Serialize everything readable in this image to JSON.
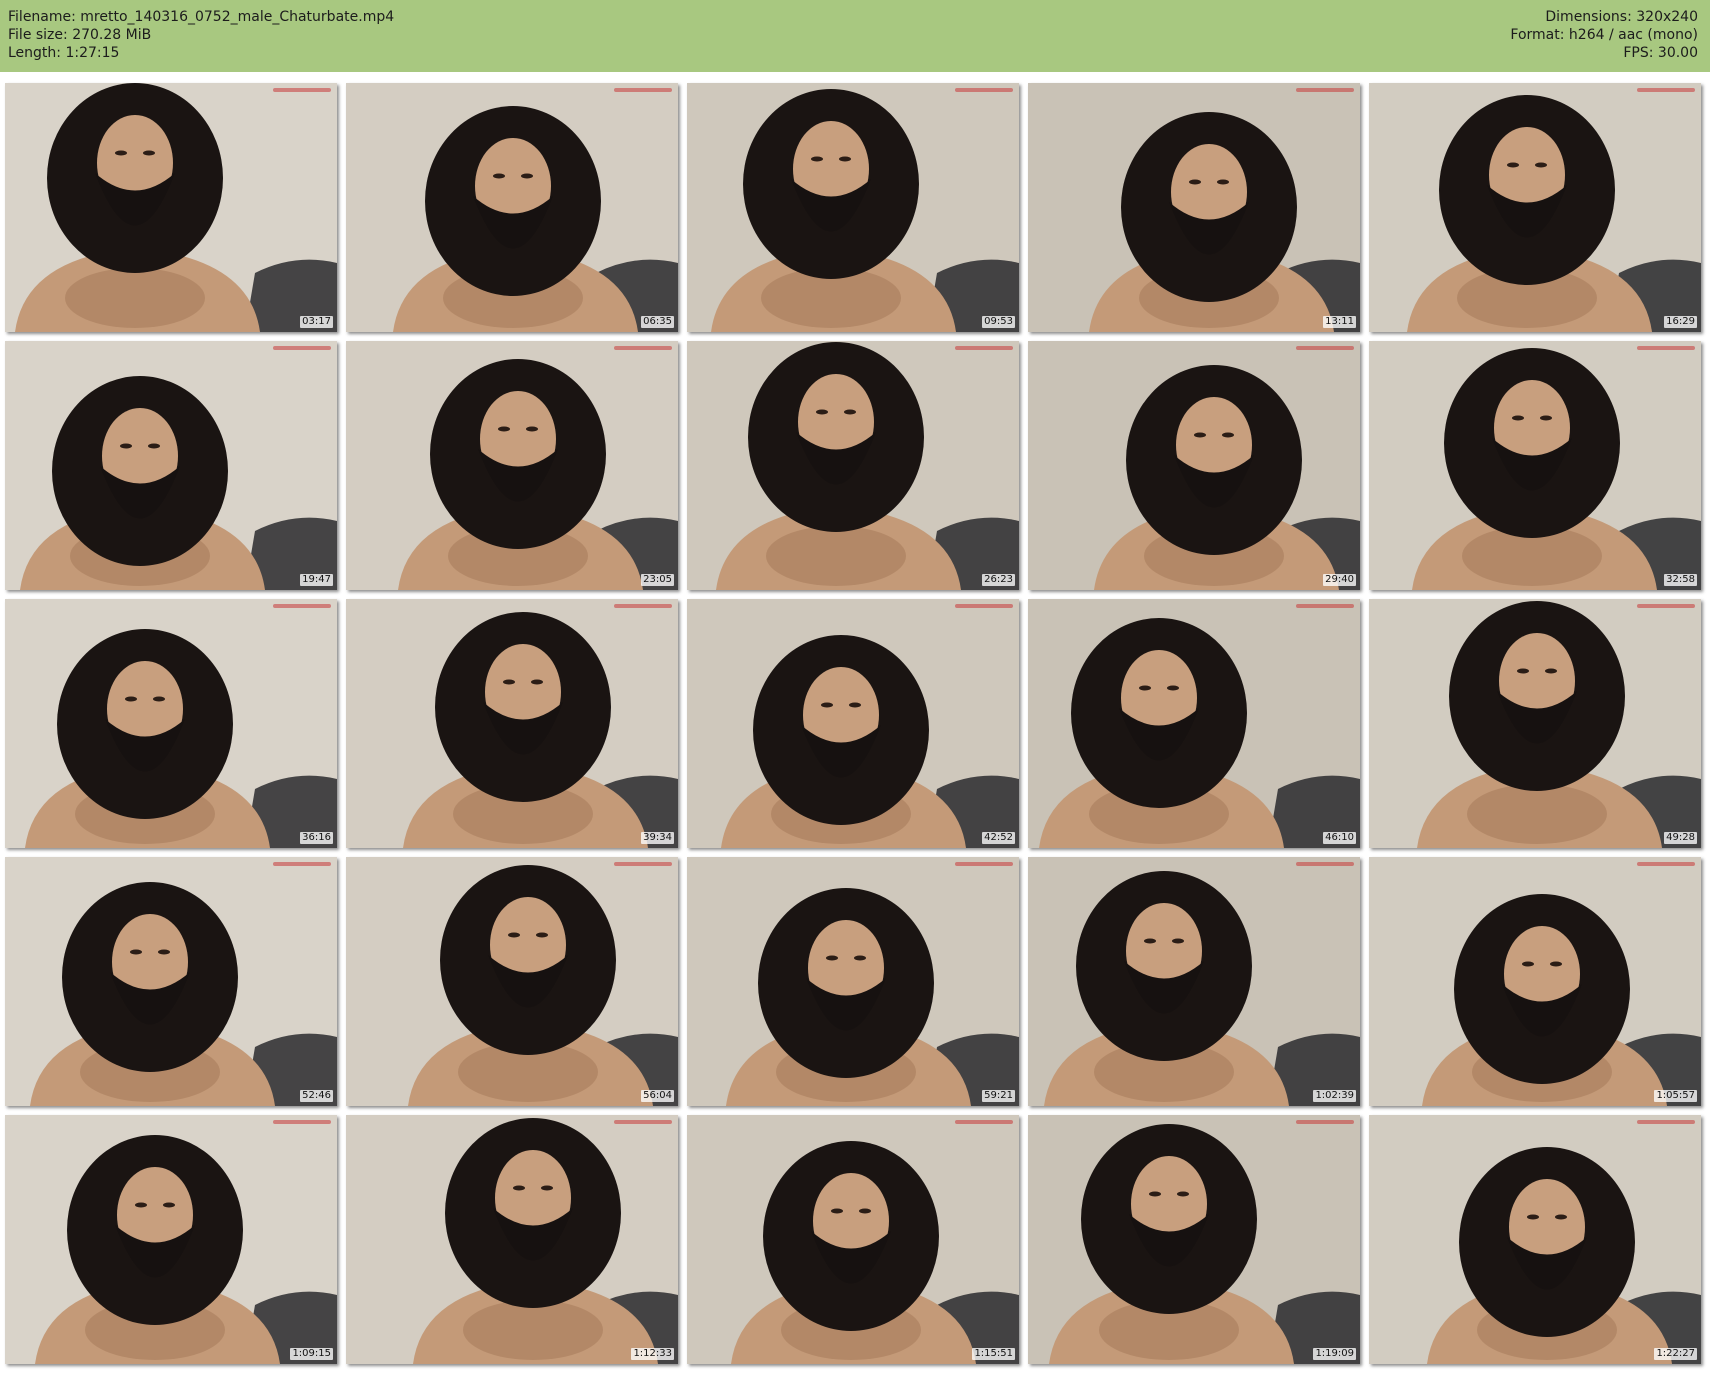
{
  "header": {
    "filename_line": "Filename: mretto_140316_0752_male_Chaturbate.mp4",
    "filesize_line": "File size: 270.28 MiB",
    "length_line": "Length: 1:27:15",
    "dimensions_line": "Dimensions: 320x240",
    "format_line": "Format: h264 / aac (mono)",
    "fps_line": "FPS: 30.00",
    "background_color": "#a8c880"
  },
  "thumbnails": [
    {
      "timestamp": "03:17"
    },
    {
      "timestamp": "06:35"
    },
    {
      "timestamp": "09:53"
    },
    {
      "timestamp": "13:11"
    },
    {
      "timestamp": "16:29"
    },
    {
      "timestamp": "19:47"
    },
    {
      "timestamp": "23:05"
    },
    {
      "timestamp": "26:23"
    },
    {
      "timestamp": "29:40"
    },
    {
      "timestamp": "32:58"
    },
    {
      "timestamp": "36:16"
    },
    {
      "timestamp": "39:34"
    },
    {
      "timestamp": "42:52"
    },
    {
      "timestamp": "46:10"
    },
    {
      "timestamp": "49:28"
    },
    {
      "timestamp": "52:46"
    },
    {
      "timestamp": "56:04"
    },
    {
      "timestamp": "59:21"
    },
    {
      "timestamp": "1:02:39"
    },
    {
      "timestamp": "1:05:57"
    },
    {
      "timestamp": "1:09:15"
    },
    {
      "timestamp": "1:12:33"
    },
    {
      "timestamp": "1:15:51"
    },
    {
      "timestamp": "1:19:09"
    },
    {
      "timestamp": "1:22:27"
    }
  ]
}
